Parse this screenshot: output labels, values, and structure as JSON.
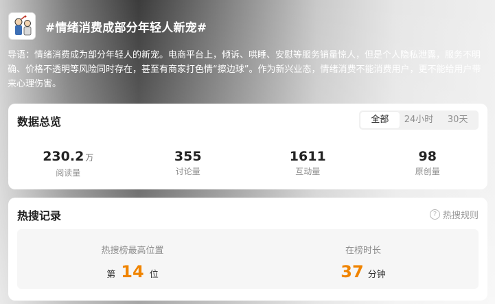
{
  "header": {
    "thumbnail_icon": "cartoon-thumbnail-icon",
    "title": "#情绪消费成部分年轻人新宠#"
  },
  "intro": {
    "text": "导语：情绪消费成为部分年轻人的新宠。电商平台上，倾诉、哄睡、安慰等服务销量惊人，但是个人隐私泄露，服务不明确、价格不透明等风险同时存在，甚至有商家打色情“擦边球”。作为新兴业态，情绪消费不能消费用户，更不能给用户带来心理伤害。"
  },
  "overview": {
    "title": "数据总览",
    "tabs": [
      {
        "label": "全部",
        "active": true
      },
      {
        "label": "24小时",
        "active": false
      },
      {
        "label": "30天",
        "active": false
      }
    ],
    "stats": [
      {
        "value": "230.2",
        "unit": "万",
        "label": "阅读量"
      },
      {
        "value": "355",
        "unit": "",
        "label": "讨论量"
      },
      {
        "value": "1611",
        "unit": "",
        "label": "互动量"
      },
      {
        "value": "98",
        "unit": "",
        "label": "原创量"
      }
    ]
  },
  "hot": {
    "title": "热搜记录",
    "rule_icon": "question-circle-icon",
    "rule_label": "热搜规则",
    "highest": {
      "label": "热搜榜最高位置",
      "prefix": "第",
      "value": "14",
      "suffix": "位"
    },
    "duration": {
      "label": "在榜时长",
      "value": "37",
      "suffix": "分钟"
    }
  },
  "colors": {
    "accent_orange": "#f08400",
    "card_bg": "#ffffff",
    "panel_bg": "#f6f6f6"
  }
}
